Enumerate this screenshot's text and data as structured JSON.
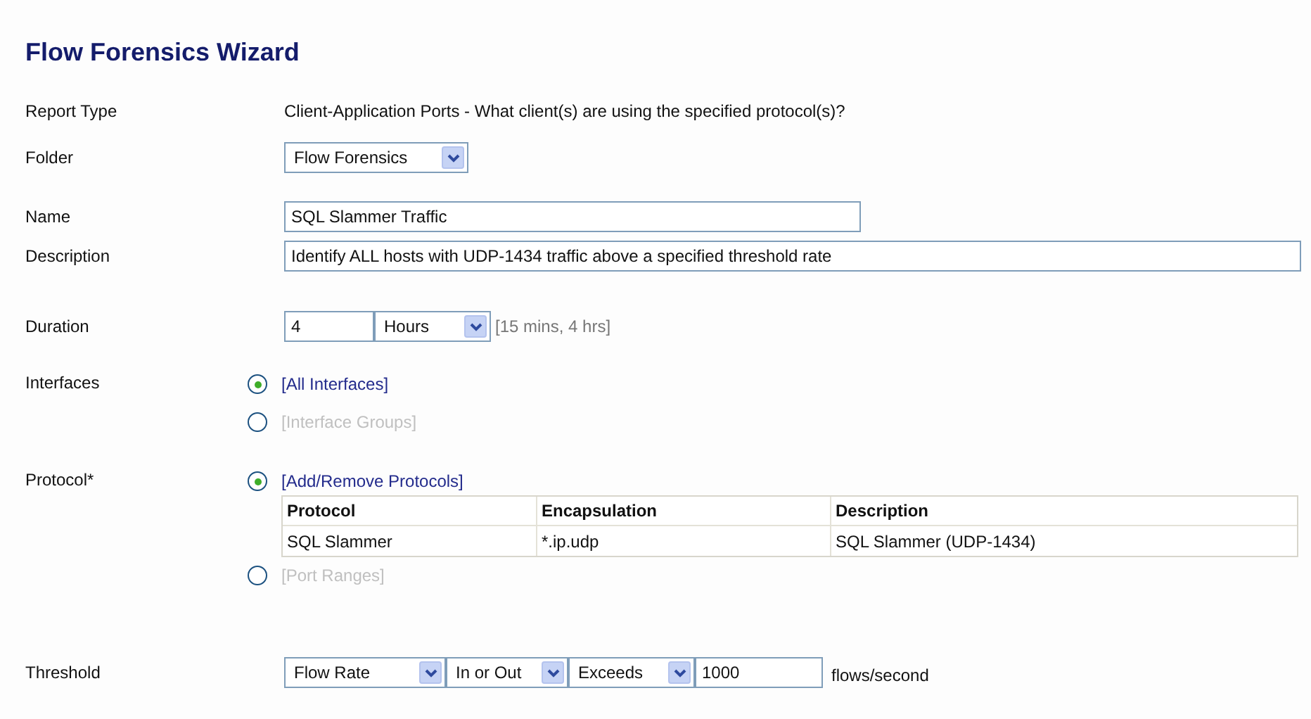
{
  "title": "Flow Forensics Wizard",
  "report_type": {
    "label": "Report Type",
    "value": "Client-Application Ports - What client(s) are using the specified protocol(s)?"
  },
  "folder": {
    "label": "Folder",
    "value": "Flow Forensics"
  },
  "name": {
    "label": "Name",
    "value": "SQL Slammer Traffic"
  },
  "description": {
    "label": "Description",
    "value": "Identify ALL hosts with UDP-1434 traffic above a specified threshold rate"
  },
  "duration": {
    "label": "Duration",
    "value": "4",
    "unit": "Hours",
    "hint": "[15 mins, 4 hrs]"
  },
  "interfaces": {
    "label": "Interfaces",
    "options": [
      {
        "label": "[All Interfaces]",
        "selected": true,
        "disabled": false
      },
      {
        "label": "[Interface Groups]",
        "selected": false,
        "disabled": true
      }
    ]
  },
  "protocol": {
    "label": "Protocol*",
    "add_option": {
      "label": "[Add/Remove Protocols]",
      "selected": true,
      "disabled": false
    },
    "table": {
      "columns": [
        "Protocol",
        "Encapsulation",
        "Description"
      ],
      "rows": [
        [
          "SQL Slammer",
          "*.ip.udp",
          "SQL Slammer (UDP-1434)"
        ]
      ]
    },
    "port_option": {
      "label": "[Port Ranges]",
      "selected": false,
      "disabled": true
    }
  },
  "threshold": {
    "label": "Threshold",
    "metric": "Flow Rate",
    "direction": "In or Out",
    "comparison": "Exceeds",
    "value": "1000",
    "unit": "flows/second"
  }
}
